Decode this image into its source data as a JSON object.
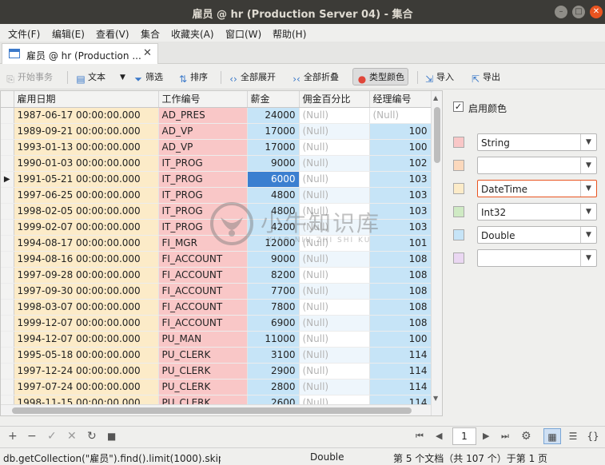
{
  "window": {
    "title": "雇员 @ hr (Production Server 04) - 集合"
  },
  "menu": [
    "文件(F)",
    "编辑(E)",
    "查看(V)",
    "集合",
    "收藏夹(A)",
    "窗口(W)",
    "帮助(H)"
  ],
  "tab": {
    "label": "雇员 @ hr (Production ..."
  },
  "toolbar": {
    "begin_tx": "开始事务",
    "text": "文本",
    "filter": "筛选",
    "sort": "排序",
    "expand_all": "全部展开",
    "collapse_all": "全部折叠",
    "type_color": "类型颜色",
    "import": "导入",
    "export": "导出"
  },
  "columns": [
    "雇用日期",
    "工作编号",
    "薪金",
    "佣金百分比",
    "经理编号"
  ],
  "null_text": "(Null)",
  "rows": [
    [
      "1987-06-17 00:00:00.000",
      "AD_PRES",
      "24000",
      "(Null)",
      "(Null)"
    ],
    [
      "1989-09-21 00:00:00.000",
      "AD_VP",
      "17000",
      "(Null)",
      "100"
    ],
    [
      "1993-01-13 00:00:00.000",
      "AD_VP",
      "17000",
      "(Null)",
      "100"
    ],
    [
      "1990-01-03 00:00:00.000",
      "IT_PROG",
      "9000",
      "(Null)",
      "102"
    ],
    [
      "1991-05-21 00:00:00.000",
      "IT_PROG",
      "6000",
      "(Null)",
      "103"
    ],
    [
      "1997-06-25 00:00:00.000",
      "IT_PROG",
      "4800",
      "(Null)",
      "103"
    ],
    [
      "1998-02-05 00:00:00.000",
      "IT_PROG",
      "4800",
      "(Null)",
      "103"
    ],
    [
      "1999-02-07 00:00:00.000",
      "IT_PROG",
      "4200",
      "(Null)",
      "103"
    ],
    [
      "1994-08-17 00:00:00.000",
      "FI_MGR",
      "12000",
      "(Null)",
      "101"
    ],
    [
      "1994-08-16 00:00:00.000",
      "FI_ACCOUNT",
      "9000",
      "(Null)",
      "108"
    ],
    [
      "1997-09-28 00:00:00.000",
      "FI_ACCOUNT",
      "8200",
      "(Null)",
      "108"
    ],
    [
      "1997-09-30 00:00:00.000",
      "FI_ACCOUNT",
      "7700",
      "(Null)",
      "108"
    ],
    [
      "1998-03-07 00:00:00.000",
      "FI_ACCOUNT",
      "7800",
      "(Null)",
      "108"
    ],
    [
      "1999-12-07 00:00:00.000",
      "FI_ACCOUNT",
      "6900",
      "(Null)",
      "108"
    ],
    [
      "1994-12-07 00:00:00.000",
      "PU_MAN",
      "11000",
      "(Null)",
      "100"
    ],
    [
      "1995-05-18 00:00:00.000",
      "PU_CLERK",
      "3100",
      "(Null)",
      "114"
    ],
    [
      "1997-12-24 00:00:00.000",
      "PU_CLERK",
      "2900",
      "(Null)",
      "114"
    ],
    [
      "1997-07-24 00:00:00.000",
      "PU_CLERK",
      "2800",
      "(Null)",
      "114"
    ],
    [
      "1998-11-15 00:00:00.000",
      "PU_CLERK",
      "2600",
      "(Null)",
      "114"
    ]
  ],
  "selected_row": 4,
  "panel": {
    "enable_color_label": "启用颜色",
    "enabled": true,
    "type_colors": [
      {
        "color": "#f9c7c7",
        "type": "String"
      },
      {
        "color": "#fbd8bc",
        "type": ""
      },
      {
        "color": "#fcebc8",
        "type": "DateTime"
      },
      {
        "color": "#cfeac4",
        "type": "Int32"
      },
      {
        "color": "#c6e4f7",
        "type": "Double"
      },
      {
        "color": "#ead7f2",
        "type": ""
      }
    ]
  },
  "watermark": {
    "title": "小牛知识库",
    "subtitle": "XIAO NIU ZHI SHI KU"
  },
  "nav": {
    "page": "1"
  },
  "status": {
    "query": "db.getCollection(\"雇员\").find().limit(1000).skip",
    "type": "Double",
    "position": "第 5 个文档（共 107 个）于第 1 页"
  }
}
